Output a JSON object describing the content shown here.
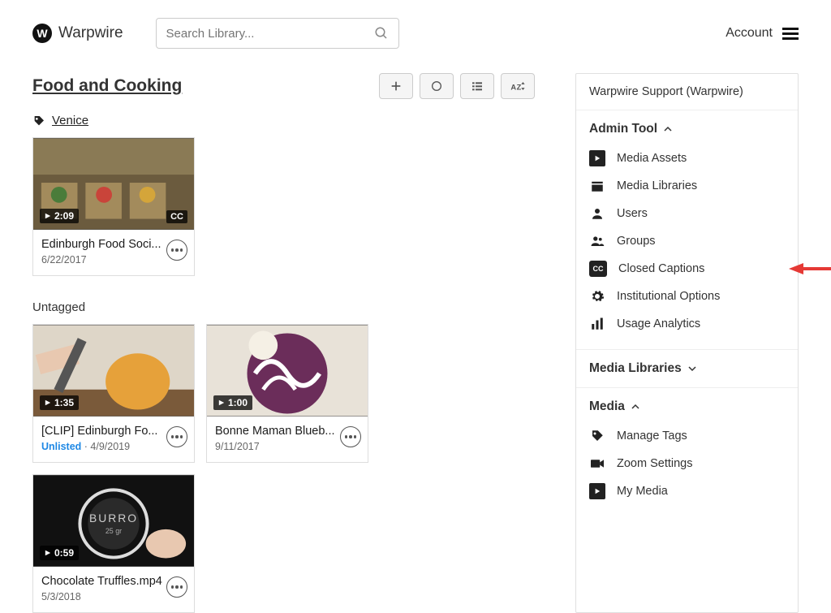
{
  "header": {
    "brand": "Warpwire",
    "search_placeholder": "Search Library...",
    "account_label": "Account"
  },
  "page": {
    "title": "Food and Cooking",
    "tag": "Venice",
    "untagged_label": "Untagged"
  },
  "cards_tagged": [
    {
      "title": "Edinburgh Food Soci...",
      "duration": "2:09",
      "date": "6/22/2017",
      "cc": true,
      "unlisted": false,
      "thumb": "market"
    }
  ],
  "cards_untagged": [
    {
      "title": "[CLIP] Edinburgh Fo...",
      "duration": "1:35",
      "date": "4/9/2019",
      "cc": false,
      "unlisted": true,
      "thumb": "peel"
    },
    {
      "title": "Bonne Maman Blueb...",
      "duration": "1:00",
      "date": "9/11/2017",
      "cc": false,
      "unlisted": false,
      "thumb": "cabbage"
    },
    {
      "title": "Chocolate Truffles.mp4",
      "duration": "0:59",
      "date": "5/3/2018",
      "cc": false,
      "unlisted": false,
      "thumb": "burro"
    }
  ],
  "sidebar": {
    "support_label": "Warpwire Support (Warpwire)",
    "sections": {
      "admin": {
        "label": "Admin Tool",
        "items": [
          {
            "label": "Media Assets",
            "icon": "play-box"
          },
          {
            "label": "Media Libraries",
            "icon": "library"
          },
          {
            "label": "Users",
            "icon": "user"
          },
          {
            "label": "Groups",
            "icon": "group"
          },
          {
            "label": "Closed Captions",
            "icon": "cc",
            "highlight": true
          },
          {
            "label": "Institutional Options",
            "icon": "gear"
          },
          {
            "label": "Usage Analytics",
            "icon": "bars"
          }
        ]
      },
      "libraries": {
        "label": "Media Libraries"
      },
      "media": {
        "label": "Media",
        "items": [
          {
            "label": "Manage Tags",
            "icon": "tag"
          },
          {
            "label": "Zoom Settings",
            "icon": "camera"
          },
          {
            "label": "My Media",
            "icon": "play-box"
          }
        ]
      }
    }
  },
  "text": {
    "unlisted": "Unlisted",
    "cc": "CC",
    "burro": "BURRO",
    "burro_sub": "25 gr"
  }
}
